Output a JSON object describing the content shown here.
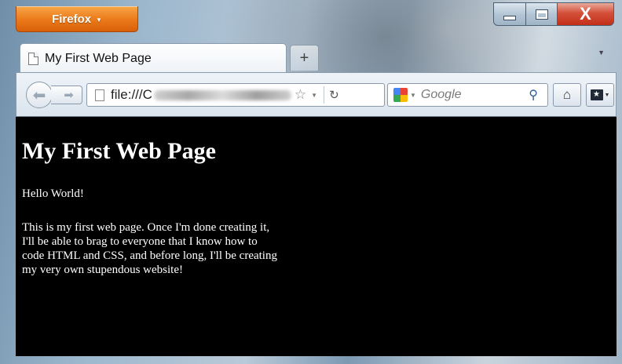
{
  "window": {
    "app_menu_label": "Firefox",
    "close_glyph": "X"
  },
  "tabs": [
    {
      "title": "My First Web Page",
      "active": true
    }
  ],
  "new_tab_label": "+",
  "navbar": {
    "url_prefix": "file:///C",
    "search_placeholder": "Google"
  },
  "page": {
    "heading": "My First Web Page",
    "para1": "Hello World!",
    "para2": "This is my first web page. Once I'm done creating it, I'll be able to brag to everyone that I know how to code HTML and CSS, and before long, I'll be creating my very own stupendous website!"
  },
  "icons": [
    "document-icon",
    "star-icon",
    "reload-icon",
    "google-icon",
    "search-icon",
    "home-icon",
    "bookmarks-icon",
    "back-icon",
    "forward-icon"
  ],
  "colors": {
    "firefox_button": "#ec7c1b",
    "close_button": "#c32f18",
    "content_bg": "#000000",
    "content_text": "#ffffff"
  }
}
